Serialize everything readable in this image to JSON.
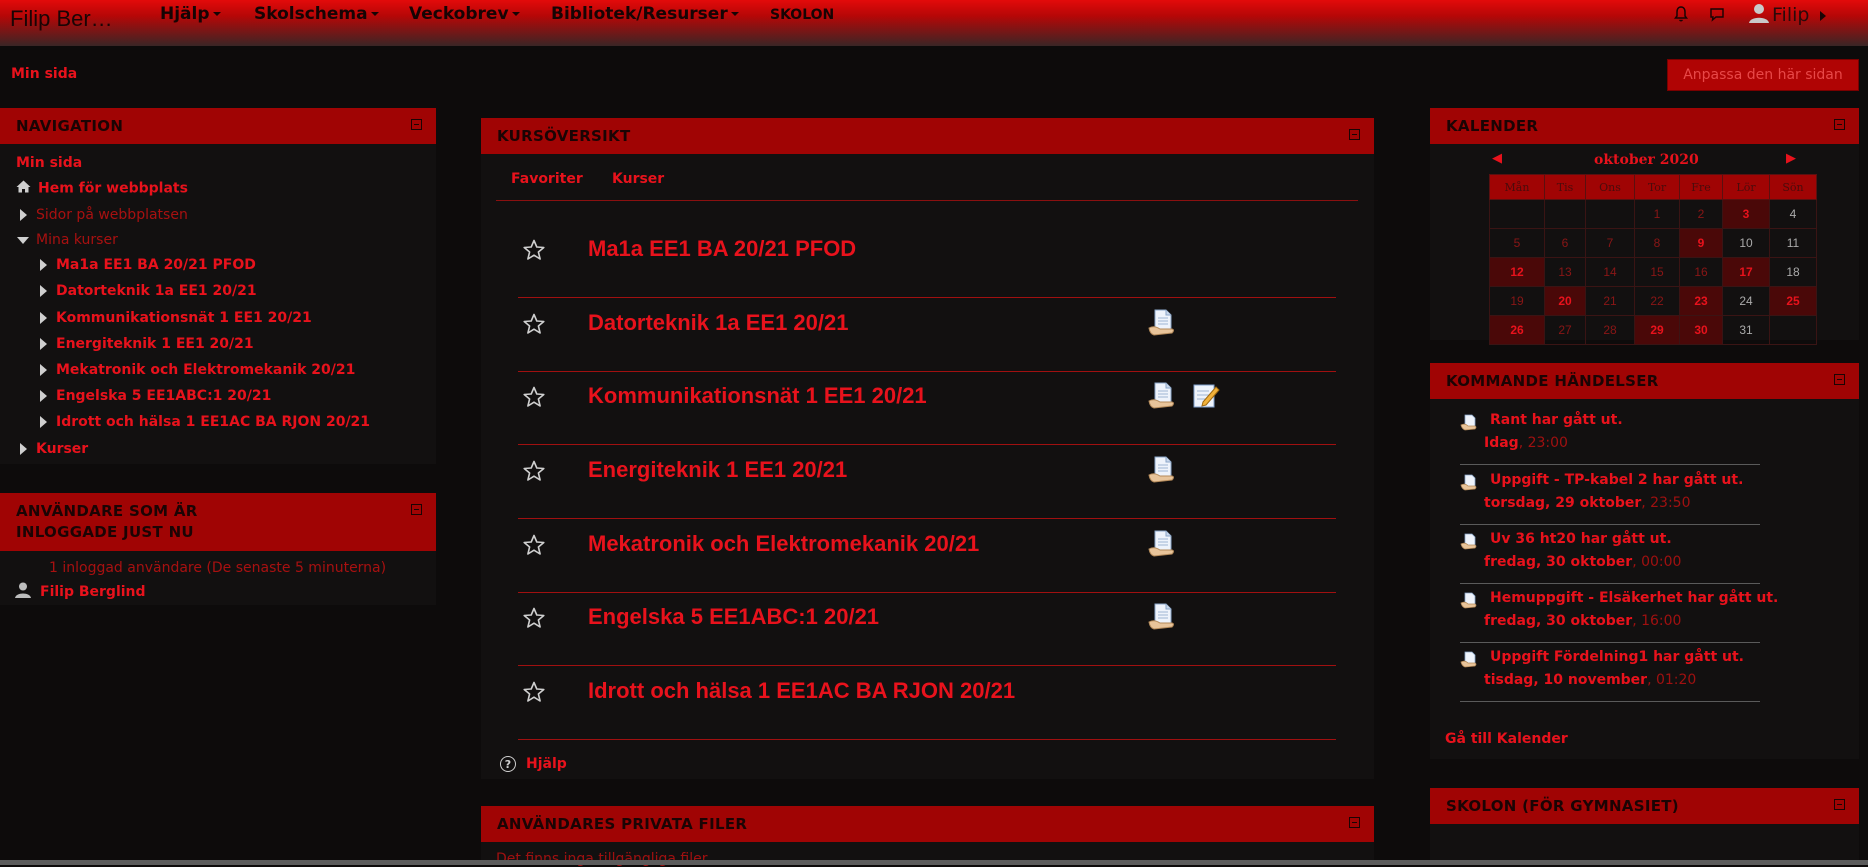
{
  "navbar": {
    "brand": "Filip Ber…",
    "menus": [
      "Hjälp",
      "Skolschema",
      "Veckobrev",
      "Bibliotek/Resurser"
    ],
    "skolon": "SKOLON",
    "user": "Filip"
  },
  "header": {
    "breadcrumb": "Min sida",
    "customize_button": "Anpassa den här sidan"
  },
  "navigation_block": {
    "title": "NAVIGATION",
    "items": {
      "min_sida": "Min sida",
      "hem": "Hem för webbplats",
      "sidor": "Sidor på webbplatsen",
      "mina_kurser": "Mina kurser",
      "kurser": "Kurser"
    },
    "courses": [
      "Ma1a EE1 BA 20/21 PFOD",
      "Datorteknik 1a EE1 20/21",
      "Kommunikationsnät 1 EE1 20/21",
      "Energiteknik 1 EE1 20/21",
      "Mekatronik och Elektromekanik 20/21",
      "Engelska 5 EE1ABC:1 20/21",
      "Idrott och hälsa 1 EE1AC BA RJON 20/21"
    ]
  },
  "online_block": {
    "title_line1": "ANVÄNDARE SOM ÄR",
    "title_line2": "INLOGGADE JUST NU",
    "count_text": "1 inloggad användare (De senaste 5 minuterna)",
    "user": "Filip Berglind"
  },
  "course_overview": {
    "title": "KURSÖVERSIKT",
    "tabs": [
      "Favoriter",
      "Kurser"
    ],
    "courses": [
      {
        "name": "Ma1a EE1 BA 20/21 PFOD",
        "icons": []
      },
      {
        "name": "Datorteknik 1a EE1 20/21",
        "icons": [
          "assignment-icon"
        ]
      },
      {
        "name": "Kommunikationsnät 1 EE1 20/21",
        "icons": [
          "assignment-icon",
          "quiz-icon"
        ]
      },
      {
        "name": "Energiteknik 1 EE1 20/21",
        "icons": [
          "assignment-icon"
        ]
      },
      {
        "name": "Mekatronik och Elektromekanik 20/21",
        "icons": [
          "assignment-icon"
        ]
      },
      {
        "name": "Engelska 5 EE1ABC:1 20/21",
        "icons": [
          "assignment-icon"
        ]
      },
      {
        "name": "Idrott och hälsa 1 EE1AC BA RJON 20/21",
        "icons": []
      }
    ],
    "help": "Hjälp"
  },
  "private_files": {
    "title": "ANVÄNDARES PRIVATA FILER",
    "text": "Det finns inga tillgängliga filer"
  },
  "calendar": {
    "title": "KALENDER",
    "month": "oktober 2020",
    "weekdays": [
      "Mån",
      "Tis",
      "Ons",
      "Tor",
      "Fre",
      "Lör",
      "Sön"
    ],
    "weeks": [
      [
        "",
        "",
        "",
        "1",
        "2",
        "3",
        "4"
      ],
      [
        "5",
        "6",
        "7",
        "8",
        "9",
        "10",
        "11"
      ],
      [
        "12",
        "13",
        "14",
        "15",
        "16",
        "17",
        "18"
      ],
      [
        "19",
        "20",
        "21",
        "22",
        "23",
        "24",
        "25"
      ],
      [
        "26",
        "27",
        "28",
        "29",
        "30",
        "31",
        ""
      ]
    ]
  },
  "upcoming": {
    "title": "KOMMANDE HÄNDELSER",
    "events": [
      {
        "title": "Rant har gått ut.",
        "day": "Idag",
        "time": ", 23:00"
      },
      {
        "title": "Uppgift - TP-kabel 2 har gått ut.",
        "day": "torsdag, 29 oktober",
        "time": ", 23:50"
      },
      {
        "title": "Uv 36 ht20 har gått ut.",
        "day": "fredag, 30 oktober",
        "time": ", 00:00"
      },
      {
        "title": "Hemuppgift - Elsäkerhet har gått ut.",
        "day": "fredag, 30 oktober",
        "time": ", 16:00"
      },
      {
        "title": "Uppgift Fördelning1 har gått ut.",
        "day": "tisdag, 10 november",
        "time": ", 01:20"
      }
    ],
    "goto": "Gå till Kalender"
  },
  "skolon_block": {
    "title": "SKOLON (FÖR GYMNASIET)"
  }
}
